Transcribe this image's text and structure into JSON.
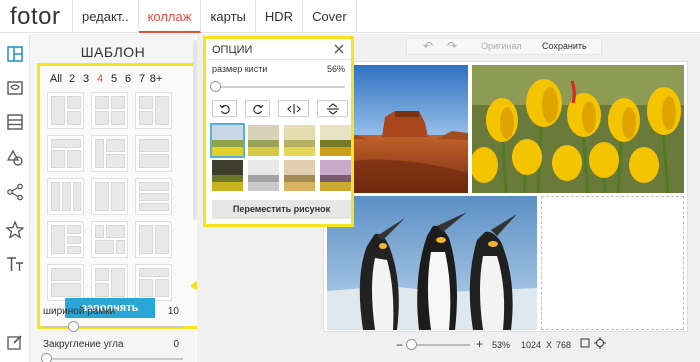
{
  "app": {
    "logo": "fotor"
  },
  "tabs": [
    {
      "label": "редакт..",
      "active": false
    },
    {
      "label": "коллаж",
      "active": true
    },
    {
      "label": "карты",
      "active": false
    },
    {
      "label": "HDR",
      "active": false
    },
    {
      "label": "Cover",
      "active": false
    }
  ],
  "rail_icons": [
    "layout-icon",
    "photo-frame-icon",
    "rows-icon",
    "shapes-icon",
    "share-icon",
    "star-icon",
    "text-icon",
    "edit-icon"
  ],
  "template_panel": {
    "title": "ШАБЛОН",
    "counts": [
      "All",
      "2",
      "3",
      "4",
      "5",
      "6",
      "7",
      "8+"
    ],
    "active_count": "4",
    "fill_button": "заполнять",
    "border_width_label": "шириной рамки",
    "border_width_value": "10",
    "corner_label": "Закругление угла",
    "corner_value": "0"
  },
  "editor_toolbar": {
    "undo_icon": "undo-icon",
    "redo_icon": "redo-icon",
    "original_label": "Оригинал",
    "save_label": "Сохранить"
  },
  "options_panel": {
    "title": "ОПЦИИ",
    "brush_label": "размер кисти",
    "brush_value": "56%",
    "tools": [
      "rotate-left-icon",
      "rotate-right-icon",
      "flip-horizontal-icon",
      "flip-vertical-icon"
    ],
    "move_button": "Переместить рисунок"
  },
  "zoom": {
    "percent": "53%",
    "width": "1024",
    "times": "X",
    "height": "768",
    "plus": "+"
  },
  "colors": {
    "accent": "#e84c3d",
    "highlight": "#f6e51e",
    "button_blue": "#2aa6d6"
  }
}
